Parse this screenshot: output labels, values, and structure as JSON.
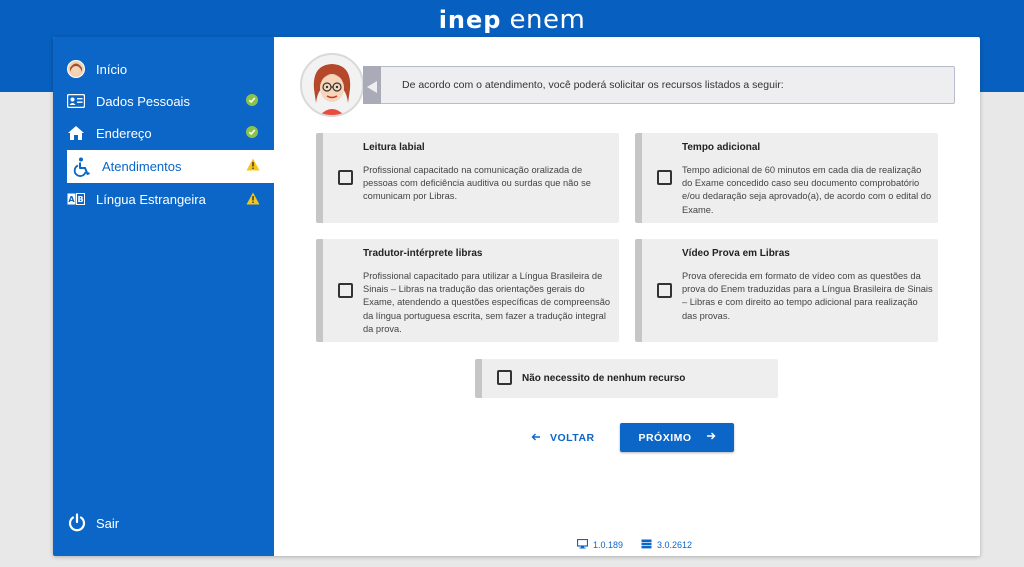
{
  "header": {
    "logo_inep": "inep",
    "logo_enem": "enem"
  },
  "sidebar": {
    "items": [
      {
        "label": "Início",
        "icon": "user-avatar-icon",
        "status": ""
      },
      {
        "label": "Dados Pessoais",
        "icon": "id-card-icon",
        "status": "check"
      },
      {
        "label": "Endereço",
        "icon": "home-icon",
        "status": "check"
      },
      {
        "label": "Atendimentos",
        "icon": "wheelchair-icon",
        "status": "warning"
      },
      {
        "label": "Língua Estrangeira",
        "icon": "translate-icon",
        "status": "warning"
      }
    ],
    "active_index": 3,
    "logout_label": "Sair"
  },
  "main": {
    "bubble_text": "De acordo com o atendimento, você poderá solicitar os recursos listados a seguir:",
    "options": [
      {
        "title": "Leitura labial",
        "desc": "Profissional capacitado na comunicação oralizada de pessoas com deficiência auditiva ou surdas que não se comunicam por Libras.",
        "checked": false
      },
      {
        "title": "Tempo adicional",
        "desc": "Tempo adicional de 60 minutos em cada dia de realização do Exame concedido caso seu documento comprobatório e/ou dedaração seja aprovado(a), de acordo com o edital do Exame.",
        "checked": false
      },
      {
        "title": "Tradutor-intérprete libras",
        "desc": "Profissional capacitado para utilizar a Língua Brasileira de Sinais – Libras na tradução das orientações gerais do Exame, atendendo a questões específicas de compreensão da língua portuguesa escrita, sem fazer a tradução integral da prova.",
        "checked": false
      },
      {
        "title": "Vídeo Prova em Libras",
        "desc": "Prova oferecida em formato de vídeo com as questões da prova do Enem traduzidas para a Língua Brasileira de Sinais – Libras e com direito ao tempo adicional para realização das provas.",
        "checked": false
      }
    ],
    "none_label": "Não necessito de nenhum recurso",
    "back_label": "VOLTAR",
    "next_label": "PRÓXIMO"
  },
  "footer": {
    "front_version": "1.0.189",
    "back_version": "3.0.2612"
  },
  "colors": {
    "brand_blue": "#0b66c8",
    "check_green": "#8bc34a",
    "warning_yellow": "#f5c518"
  }
}
